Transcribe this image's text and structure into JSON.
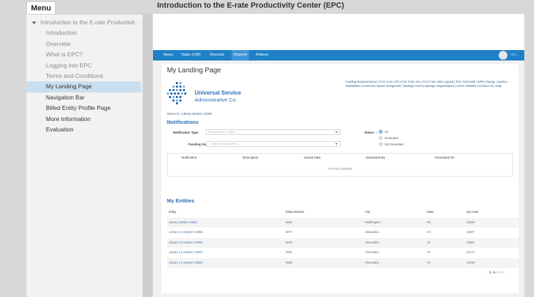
{
  "title": "Introduction to the E-rate Productivity Center (EPC)",
  "menu": {
    "tab_label": "Menu",
    "parent": "Introduction to the E-rate Productivity Center (EPC)",
    "items": [
      {
        "label": "Introduction"
      },
      {
        "label": "Overview"
      },
      {
        "label": "What is EPC?"
      },
      {
        "label": "Logging into EPC"
      },
      {
        "label": "Terms and Conditions"
      },
      {
        "label": "My Landing Page"
      },
      {
        "label": "Navigation Bar"
      },
      {
        "label": "Billed Entity Profile Page"
      },
      {
        "label": "More Information"
      },
      {
        "label": "Evaluation"
      }
    ],
    "active_index": 5
  },
  "app": {
    "nav": [
      {
        "label": "News"
      },
      {
        "label": "Tasks (148)"
      },
      {
        "label": "Records"
      },
      {
        "label": "Reports"
      },
      {
        "label": "Actions"
      }
    ],
    "active_nav": "Reports",
    "user_name": "Libr...",
    "page_title": "My Landing Page",
    "links": "Funding Request Report | FCC Form 470 | FCC Form 471 | FCC Form 486 | Appeal | FCC Form 500 | SPIN Change | Service Substitution | Hurricane Impact Designation | Manage Users | Manage Organizations | USAC Website | Contact Us | Help",
    "logo": {
      "line1": "Universal Service",
      "line2": "Administrative Co."
    },
    "welcome_prefix": "Welcome,",
    "welcome_user": "Library System 13001",
    "notifications": {
      "heading": "Notifications",
      "type_label": "Notification Type",
      "type_placeholder": "Please select a value",
      "year_label": "Funding Year",
      "year_placeholder": "-- Select a funding Year --",
      "status_label": "Status",
      "status_options": [
        "All",
        "Generated",
        "Not Generated"
      ],
      "status_selected": "All",
      "columns": [
        "Notification",
        "Description",
        "Issued Date",
        "Generated By",
        "Generated On"
      ],
      "empty_text": "No items available"
    },
    "entities": {
      "heading": "My Entities",
      "columns": [
        "Entity",
        "Entity Number",
        "City",
        "State",
        "Zip Code"
      ],
      "rows": [
        [
          "Library System 13001",
          "8816",
          "Washington",
          "DC",
          "20036"
        ],
        [
          "Library 1 in System 13001",
          "9077",
          "Alexandria",
          "VA",
          "22207"
        ],
        [
          "Library 2 in System 13001",
          "9079",
          "Alexandria",
          "VA",
          "23687"
        ],
        [
          "Library 3 in System 13001",
          "9081",
          "Alexandria",
          "VA",
          "22177"
        ],
        [
          "Library 4 in System 13001",
          "9083",
          "Alexandria",
          "VA",
          "23159"
        ]
      ],
      "pager": {
        "prev": "‹",
        "range": "1 - 5",
        "of_text": "of 11",
        "next": "›"
      }
    }
  },
  "colors": {
    "nav": "#1f80c8",
    "accent": "#2a6fb5",
    "active_menu": "#c9dff0"
  }
}
